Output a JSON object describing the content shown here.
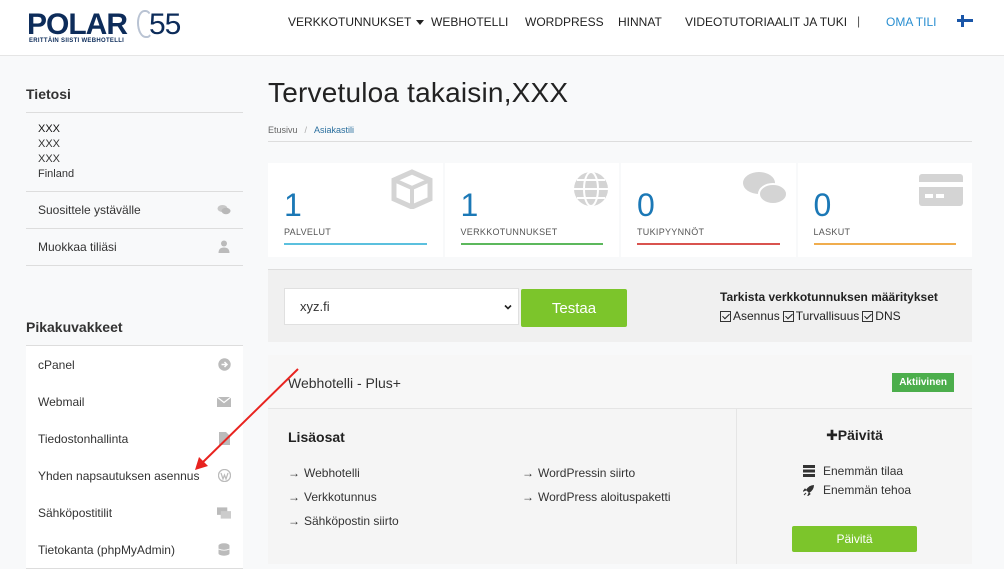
{
  "brand": {
    "logo_word": "POLAR",
    "logo_num": "55",
    "tagline": "ERITTÄIN SIISTI WEBHOTELLI"
  },
  "nav": {
    "items": [
      {
        "label": "VERKKOTUNNUKSET",
        "has_dropdown": true
      },
      {
        "label": "WEBHOTELLI"
      },
      {
        "label": "WORDPRESS"
      },
      {
        "label": "HINNAT"
      },
      {
        "label": "VIDEOTUTORIAALIT JA TUKI"
      }
    ],
    "separator": "|",
    "account": "OMA TILI",
    "account_color": "#2a8fd1",
    "language_flag": "finland-flag-icon"
  },
  "sidebar": {
    "info_title": "Tietosi",
    "info_lines": [
      "XXX",
      "XXX",
      "XXX",
      "Finland"
    ],
    "info_links": [
      {
        "label": "Suosittele ystävälle",
        "icon": "comments-icon"
      },
      {
        "label": "Muokkaa tiliäsi",
        "icon": "user-icon"
      }
    ],
    "shortcuts_title": "Pikakuvakkeet",
    "shortcuts": [
      {
        "label": "cPanel",
        "icon": "arrow-circle-right-icon"
      },
      {
        "label": "Webmail",
        "icon": "envelope-icon"
      },
      {
        "label": "Tiedostonhallinta",
        "icon": "file-icon"
      },
      {
        "label": "Yhden napsautuksen asennus",
        "icon": "wordpress-icon"
      },
      {
        "label": "Sähköpostitilit",
        "icon": "inbox-icon"
      },
      {
        "label": "Tietokanta (phpMyAdmin)",
        "icon": "database-icon"
      }
    ]
  },
  "main": {
    "title": "Tervetuloa takaisin,XXX",
    "breadcrumb": {
      "home": "Etusivu",
      "separator": "/",
      "current": "Asiakastili"
    },
    "tiles": [
      {
        "count": "1",
        "label": "PALVELUT",
        "icon": "cube-icon",
        "color": "#5bc0de"
      },
      {
        "count": "1",
        "label": "VERKKOTUNNUKSET",
        "icon": "globe-icon",
        "color": "#5cb85c"
      },
      {
        "count": "0",
        "label": "TUKIPYYNNÖT",
        "icon": "comments-icon",
        "color": "#d9534f"
      },
      {
        "count": "0",
        "label": "LASKUT",
        "icon": "credit-card-icon",
        "color": "#f0ad4e"
      }
    ],
    "domain_check": {
      "selected_domain": "xyz.fi",
      "button_label": "Testaa",
      "title": "Tarkista verkkotunnuksen määritykset",
      "options": [
        "Asennus",
        "Turvallisuus",
        "DNS"
      ]
    },
    "service": {
      "name": "Webhotelli - Plus+",
      "status": "Aktiivinen",
      "addons_title": "Lisäosat",
      "addons_left": [
        "Webhotelli",
        "Verkkotunnus",
        "Sähköpostin siirto"
      ],
      "addons_right": [
        "WordPressin siirto",
        "WordPress aloituspaketti"
      ],
      "upgrade_title": "Päivitä",
      "upgrade_items": [
        {
          "label": "Enemmän tilaa",
          "icon": "server-icon"
        },
        {
          "label": "Enemmän tehoa",
          "icon": "rocket-icon"
        }
      ],
      "upgrade_button": "Päivitä"
    }
  }
}
